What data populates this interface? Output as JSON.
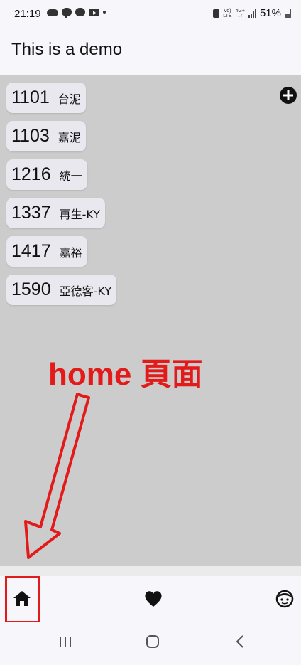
{
  "status_bar": {
    "time": "21:19",
    "network_top": "Vo)",
    "network_bottom": "LTE",
    "signal_top": "4G+",
    "battery_percent": "51%"
  },
  "app_bar": {
    "title": "This is a demo"
  },
  "stocks": [
    {
      "code": "1101",
      "name": "台泥"
    },
    {
      "code": "1103",
      "name": "嘉泥"
    },
    {
      "code": "1216",
      "name": "統一"
    },
    {
      "code": "1337",
      "name": "再生-KY"
    },
    {
      "code": "1417",
      "name": "嘉裕"
    },
    {
      "code": "1590",
      "name": "亞德客-KY"
    }
  ],
  "annotation": {
    "label": "home 頁面",
    "color": "#e31a1a"
  },
  "bottom_nav": {
    "items": [
      {
        "icon": "home-icon"
      },
      {
        "icon": "heart-icon"
      },
      {
        "icon": "face-icon"
      }
    ]
  },
  "colors": {
    "app_background": "#f7f6fb",
    "content_background": "#cccccc",
    "chip_background": "#eae8ef"
  }
}
